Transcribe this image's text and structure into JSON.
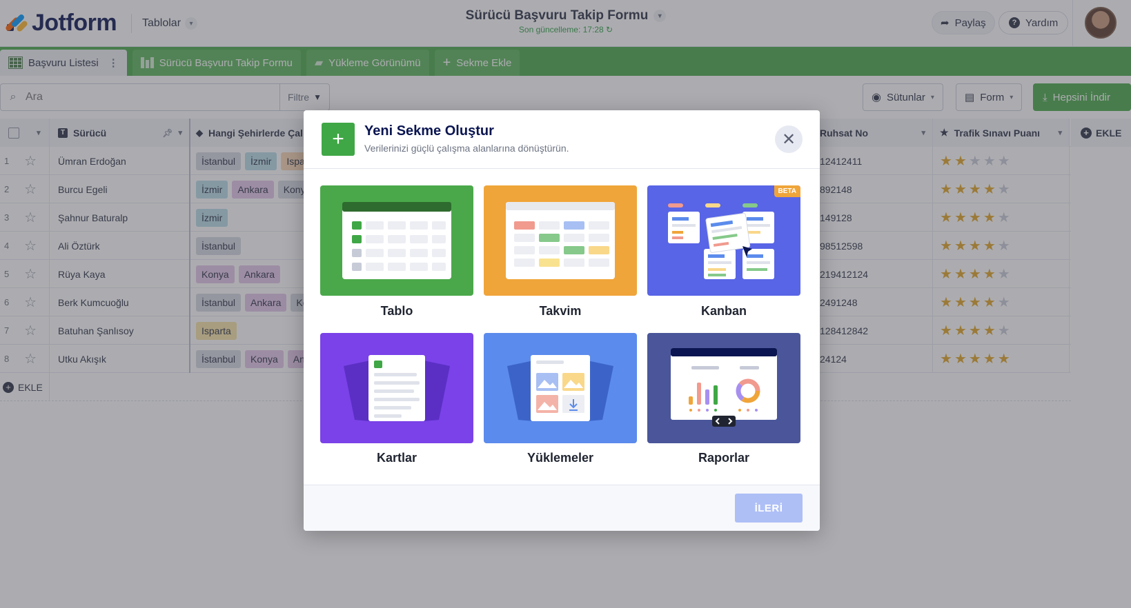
{
  "header": {
    "logo_text": "Jotform",
    "tables_label": "Tablolar",
    "form_title": "Sürücü Başvuru Takip Formu",
    "last_update": "Son güncelleme: 17:28",
    "share_label": "Paylaş",
    "help_label": "Yardım"
  },
  "tabs": [
    {
      "label": "Başvuru Listesi",
      "icon": "grid-icon",
      "active": true
    },
    {
      "label": "Sürücü Başvuru Takip Formu",
      "icon": "form-icon",
      "active": false
    },
    {
      "label": "Yükleme Görünümü",
      "icon": "upload-folder-icon",
      "active": false
    },
    {
      "label": "Sekme Ekle",
      "icon": "plus-icon",
      "active": false
    }
  ],
  "toolbar": {
    "search_placeholder": "Ara",
    "filter_label": "Filtre",
    "columns_label": "Sütunlar",
    "form_label": "Form",
    "download_label": "Hepsini İndir"
  },
  "table": {
    "columns": {
      "driver": "Sürücü",
      "cities": "Hangi Şehirlerde Çal",
      "license": "Ruhsat No",
      "score": "Trafik Sınavı Puanı",
      "add": "EKLE"
    },
    "rows": [
      {
        "num": "1",
        "name": "Ümran Erdoğan",
        "cities": [
          "İstanbul",
          "İzmir",
          "Ispa"
        ],
        "license": "12412411",
        "stars": 2
      },
      {
        "num": "2",
        "name": "Burcu Egeli",
        "cities": [
          "İzmir",
          "Ankara",
          "Kony"
        ],
        "license": "892148",
        "stars": 4
      },
      {
        "num": "3",
        "name": "Şahnur Baturalp",
        "cities": [
          "İzmir"
        ],
        "license": "149128",
        "stars": 4
      },
      {
        "num": "4",
        "name": "Ali Öztürk",
        "cities": [
          "İstanbul"
        ],
        "license": "98512598",
        "stars": 4
      },
      {
        "num": "5",
        "name": "Rüya Kaya",
        "cities": [
          "Konya",
          "Ankara"
        ],
        "license": "219412124",
        "stars": 4
      },
      {
        "num": "6",
        "name": "Berk Kumcuoğlu",
        "cities": [
          "İstanbul",
          "Ankara",
          "Ko"
        ],
        "license": "2491248",
        "stars": 4
      },
      {
        "num": "7",
        "name": "Batuhan Şanlısoy",
        "cities": [
          "Isparta"
        ],
        "license": "128412842",
        "stars": 4
      },
      {
        "num": "8",
        "name": "Utku Akışık",
        "cities": [
          "İstanbul",
          "Konya",
          "An"
        ],
        "license": "24124",
        "stars": 5
      }
    ],
    "add_row_label": "EKLE"
  },
  "modal": {
    "title": "Yeni Sekme Oluştur",
    "subtitle": "Verilerinizi güçlü çalışma alanlarına dönüştürün.",
    "cards": [
      {
        "label": "Tablo",
        "color": "#4aa84a"
      },
      {
        "label": "Takvim",
        "color": "#f0a53a"
      },
      {
        "label": "Kanban",
        "color": "#5865e6",
        "badge": "BETA"
      },
      {
        "label": "Kartlar",
        "color": "#7a42e8"
      },
      {
        "label": "Yüklemeler",
        "color": "#5b8bec"
      },
      {
        "label": "Raporlar",
        "color": "#4a5699"
      }
    ],
    "next_label": "İLERİ"
  },
  "colors": {
    "brand_green": "#4aa84a",
    "modal_next_disabled": "#aebff6",
    "star": "#e0a526"
  }
}
